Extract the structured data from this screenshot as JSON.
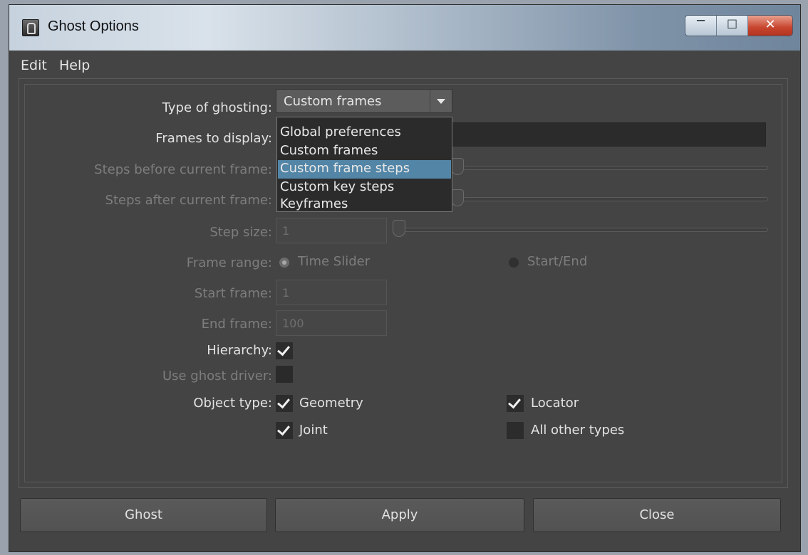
{
  "window": {
    "title": "Ghost Options",
    "icons": {
      "app": "ghost-app-icon",
      "minimize": "minimize-icon",
      "maximize": "maximize-icon",
      "close": "close-icon"
    }
  },
  "menu": {
    "edit": "Edit",
    "help": "Help"
  },
  "form": {
    "type_label": "Type of ghosting:",
    "type_value": "Custom frames",
    "frames_label": "Frames to display:",
    "frames_value": "",
    "steps_before_label": "Steps before current frame:",
    "steps_after_label": "Steps after current frame:",
    "step_size_label": "Step size:",
    "step_size_value": "1",
    "frame_range_label": "Frame range:",
    "frame_range_options": [
      "Time Slider",
      "Start/End"
    ],
    "frame_range_selected": "Time Slider",
    "start_frame_label": "Start frame:",
    "start_frame_value": "1",
    "end_frame_label": "End frame:",
    "end_frame_value": "100",
    "hierarchy_label": "Hierarchy:",
    "hierarchy_checked": true,
    "ghost_driver_label": "Use ghost driver:",
    "ghost_driver_checked": false,
    "object_type_label": "Object type:",
    "object_types": [
      {
        "label": "Geometry",
        "checked": true
      },
      {
        "label": "Locator",
        "checked": true
      },
      {
        "label": "Joint",
        "checked": true
      },
      {
        "label": "All other types",
        "checked": false
      }
    ]
  },
  "dropdown": {
    "options": [
      "Global preferences",
      "Custom frames",
      "Custom frame steps",
      "Custom key steps",
      "Keyframes"
    ],
    "highlighted": "Custom frame steps"
  },
  "buttons": {
    "ghost": "Ghost",
    "apply": "Apply",
    "close": "Close"
  },
  "colors": {
    "panel": "#444444",
    "highlight": "#5285a6",
    "text": "#e2e2e2",
    "disabled_text": "#7d7d7d"
  }
}
